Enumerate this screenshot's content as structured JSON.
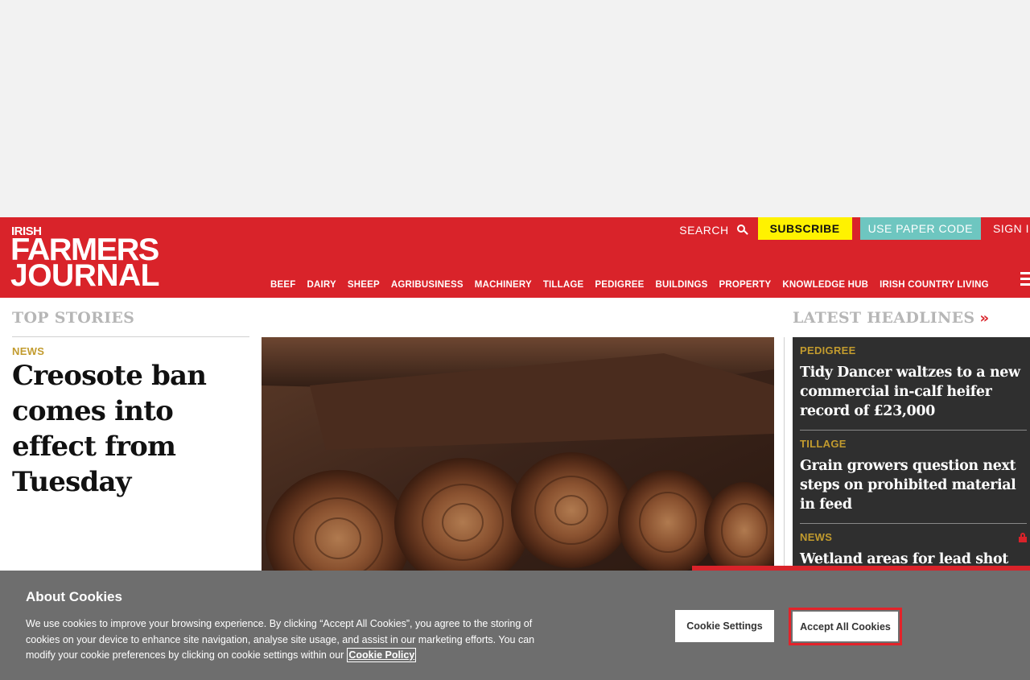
{
  "header": {
    "logo": {
      "line1": "IRISH",
      "line2": "FARMERS",
      "line3": "JOURNAL"
    },
    "search_label": "SEARCH",
    "subscribe_label": "SUBSCRIBE",
    "paper_code_label": "USE PAPER CODE",
    "sign_in_label": "SIGN IN",
    "nav": [
      "BEEF",
      "DAIRY",
      "SHEEP",
      "AGRIBUSINESS",
      "MACHINERY",
      "TILLAGE",
      "PEDIGREE",
      "BUILDINGS",
      "PROPERTY",
      "KNOWLEDGE HUB",
      "IRISH COUNTRY LIVING"
    ],
    "colors": {
      "brand": "#d9232a",
      "subscribe": "#fff200",
      "paper_code": "#6ec6c0"
    }
  },
  "top_stories": {
    "title": "TOP STORIES",
    "lead": {
      "category": "NEWS",
      "headline": "Creosote ban comes into effect from Tuesday"
    }
  },
  "latest_headlines": {
    "title": "LATEST HEADLINES",
    "items": [
      {
        "category": "PEDIGREE",
        "title": "Tidy Dancer waltzes to a new commercial in-calf heifer record of £23,000"
      },
      {
        "category": "TILLAGE",
        "title": "Grain growers question next steps on prohibited material in feed"
      },
      {
        "category": "NEWS",
        "title": "Wetland areas for lead shot ban",
        "locked": true
      }
    ]
  },
  "cookie_banner": {
    "title": "About Cookies",
    "body": "We use cookies to improve your browsing experience. By clicking “Accept All Cookies”, you agree to the storing of cookies on your device to enhance site navigation, analyse site usage, and assist in our marketing efforts. You can modify your cookie preferences by clicking on cookie settings within our",
    "policy_link": "Cookie Policy",
    "settings_button": "Cookie Settings",
    "accept_button": "Accept All Cookies"
  }
}
